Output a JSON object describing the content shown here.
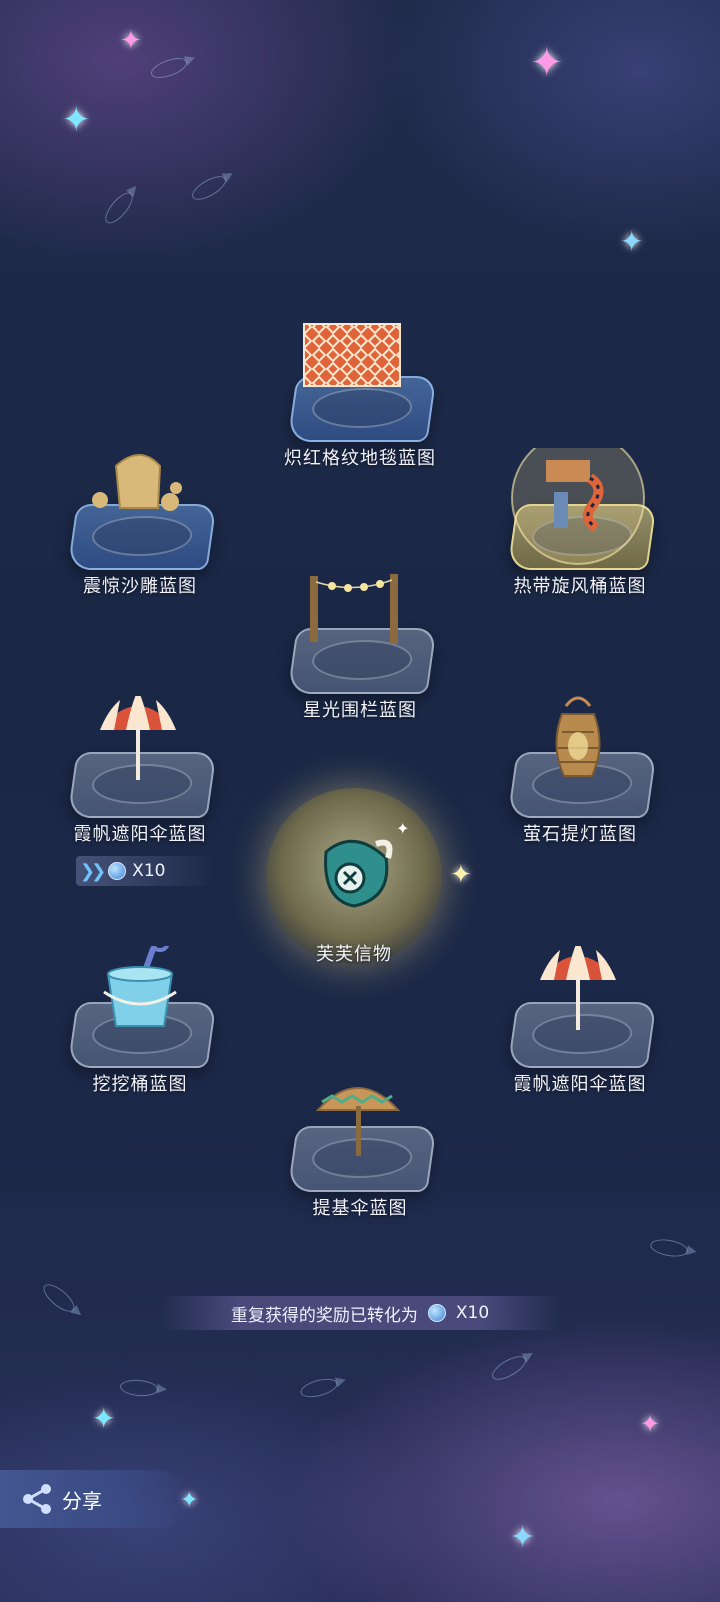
{
  "items": [
    {
      "label": "炽红格纹地毯蓝图"
    },
    {
      "label": "震惊沙雕蓝图"
    },
    {
      "label": "热带旋风桶蓝图"
    },
    {
      "label": "星光围栏蓝图"
    },
    {
      "label": "霞帆遮阳伞蓝图"
    },
    {
      "label": "萤石提灯蓝图"
    },
    {
      "label": "挖挖桶蓝图"
    },
    {
      "label": "霞帆遮阳伞蓝图"
    },
    {
      "label": "提基伞蓝图"
    }
  ],
  "center": {
    "label": "芙芙信物"
  },
  "duplicate_badge": {
    "value": "X10"
  },
  "notice": {
    "text": "重复获得的奖励已转化为",
    "value": "X10"
  },
  "share": {
    "label": "分享"
  },
  "colors": {
    "accent": "#6fc3ff",
    "gold": "#f0dc8c"
  }
}
